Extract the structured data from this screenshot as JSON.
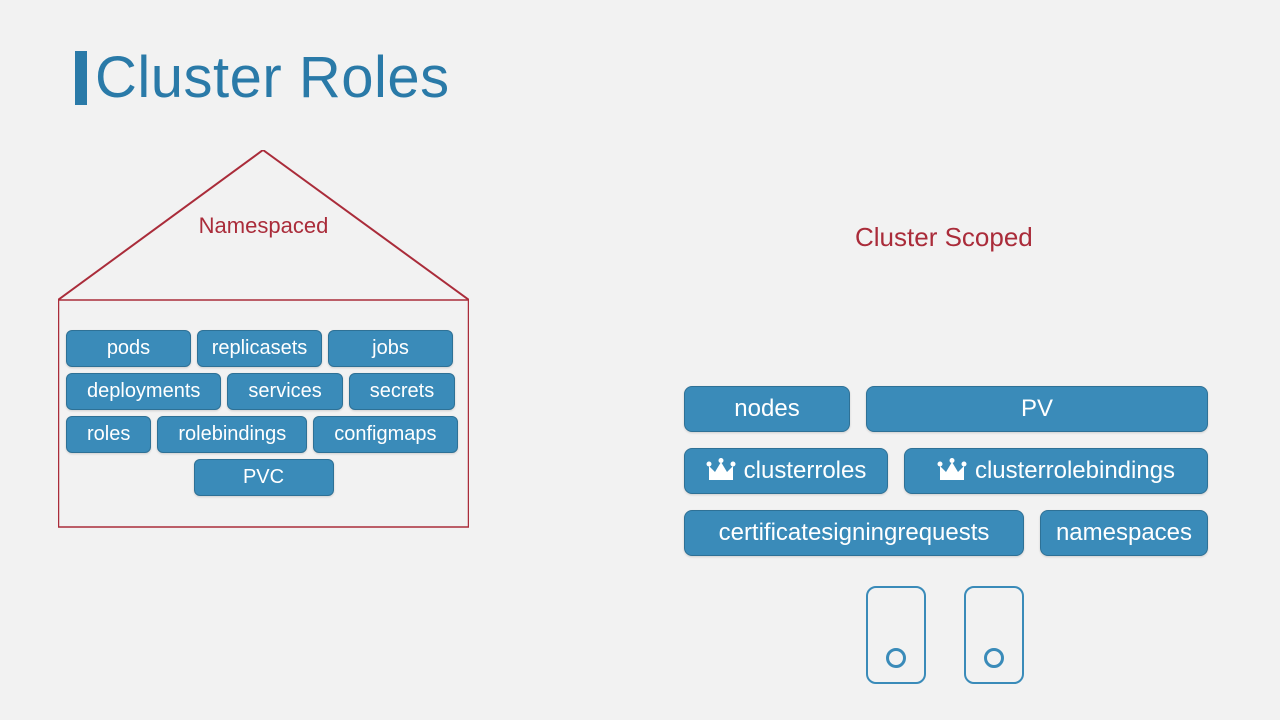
{
  "title": "Cluster Roles",
  "namespaced": {
    "label": "Namespaced",
    "rows": [
      [
        "pods",
        "replicasets",
        "jobs"
      ],
      [
        "deployments",
        "services",
        "secrets"
      ],
      [
        "roles",
        "rolebindings",
        "configmaps"
      ],
      [
        "PVC"
      ]
    ]
  },
  "cluster": {
    "label": "Cluster Scoped",
    "r0": {
      "a": "nodes",
      "b": "PV"
    },
    "r1": {
      "a": "clusterroles",
      "b": "clusterrolebindings"
    },
    "r2": {
      "a": "certificatesigningrequests",
      "b": "namespaces"
    }
  }
}
